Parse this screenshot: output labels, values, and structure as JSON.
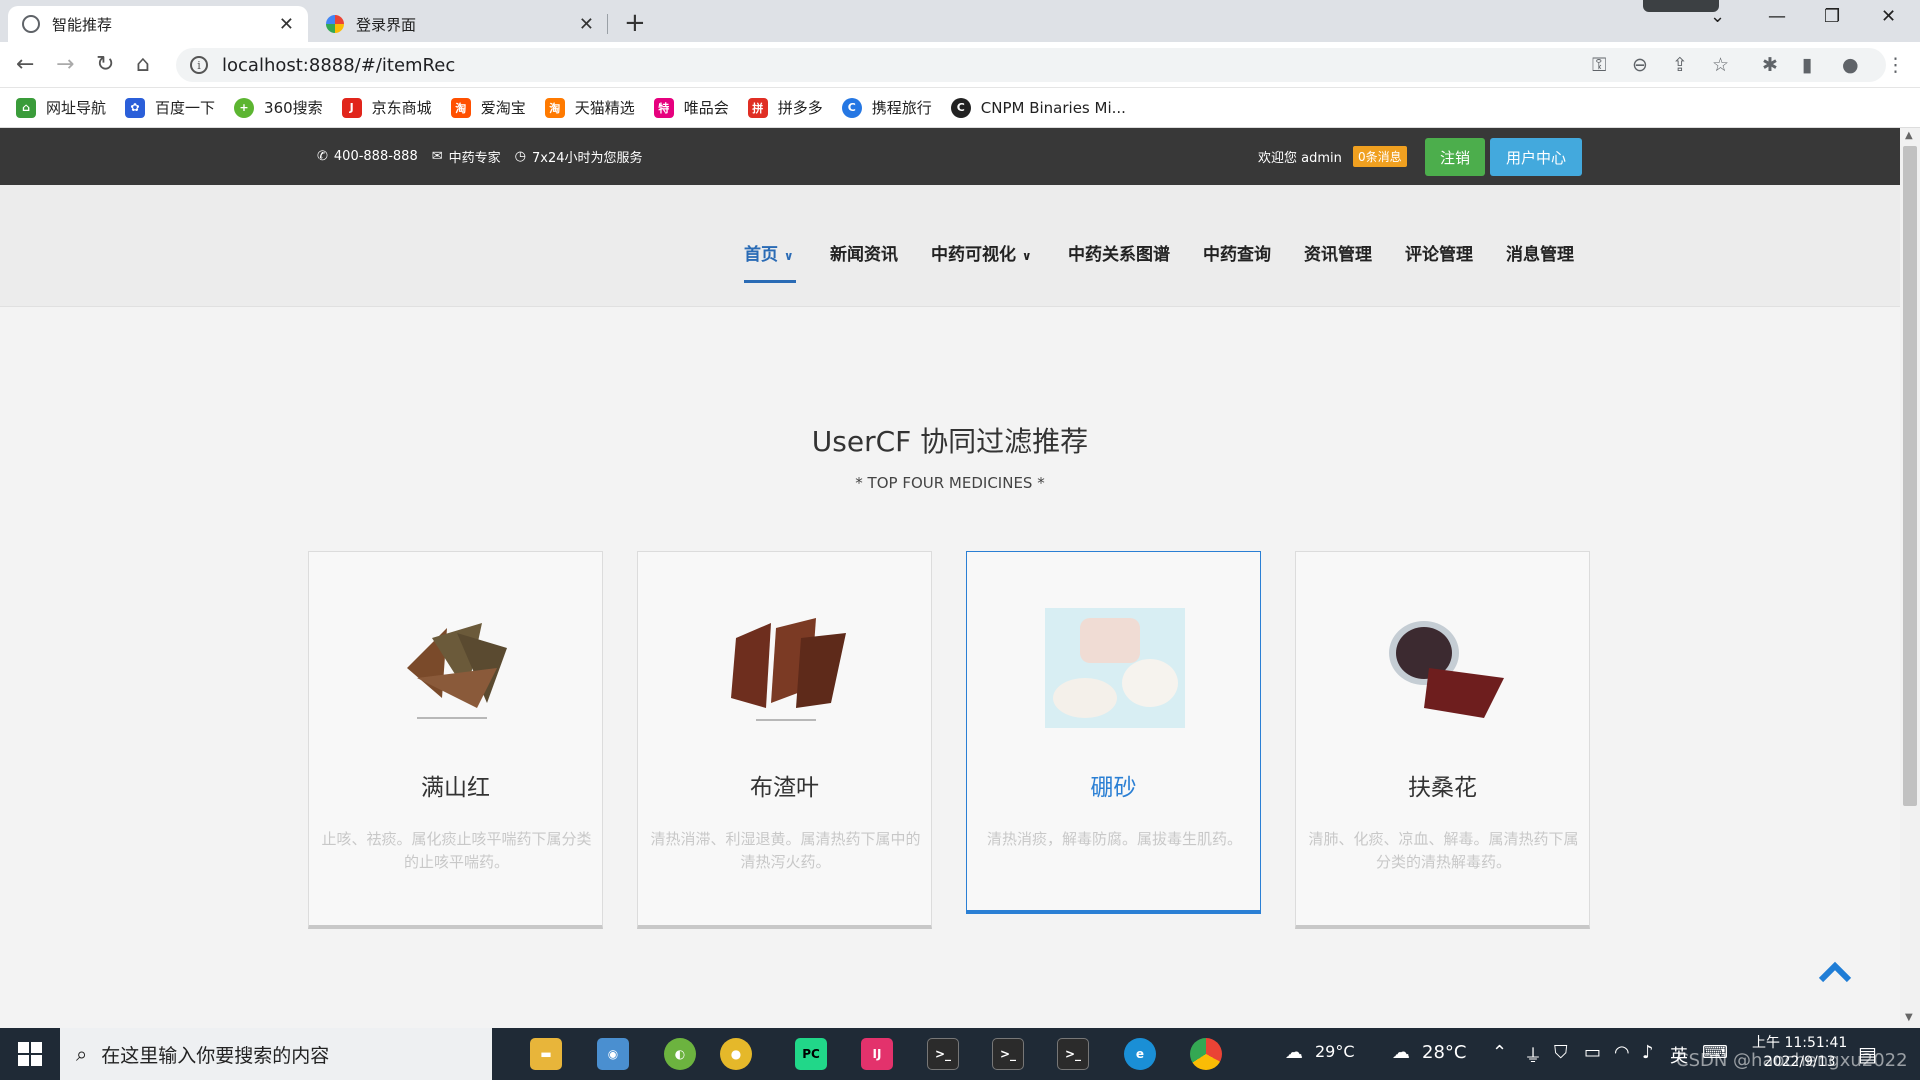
{
  "browser": {
    "tabs": [
      {
        "title": "智能推荐",
        "active": true
      },
      {
        "title": "登录界面",
        "active": false
      }
    ],
    "url": "localhost:8888/#/itemRec",
    "bookmarks": [
      {
        "label": "网址导航",
        "color": "#3a9c3a"
      },
      {
        "label": "百度一下",
        "color": "#2b5fd9"
      },
      {
        "label": "360搜索",
        "color": "#5cb531"
      },
      {
        "label": "京东商城",
        "color": "#e1251b"
      },
      {
        "label": "爱淘宝",
        "color": "#ff5000"
      },
      {
        "label": "天猫精选",
        "color": "#ff7a00"
      },
      {
        "label": "唯品会",
        "color": "#e6007e"
      },
      {
        "label": "拼多多",
        "color": "#e02e24"
      },
      {
        "label": "携程旅行",
        "color": "#2577e3"
      },
      {
        "label": "CNPM Binaries Mi...",
        "color": "#222222"
      }
    ]
  },
  "site": {
    "topbar": {
      "phone": "400-888-888",
      "email": "中药专家",
      "hours": "7x24小时为您服务",
      "welcome": "欢迎您 admin",
      "messages_badge": "0条消息",
      "logout_label": "注销",
      "user_center_label": "用户中心"
    },
    "nav": [
      {
        "label": "首页",
        "dropdown": true,
        "active": true
      },
      {
        "label": "新闻资讯",
        "dropdown": false,
        "active": false
      },
      {
        "label": "中药可视化",
        "dropdown": true,
        "active": false
      },
      {
        "label": "中药关系图谱",
        "dropdown": false,
        "active": false
      },
      {
        "label": "中药查询",
        "dropdown": false,
        "active": false
      },
      {
        "label": "资讯管理",
        "dropdown": false,
        "active": false
      },
      {
        "label": "评论管理",
        "dropdown": false,
        "active": false
      },
      {
        "label": "消息管理",
        "dropdown": false,
        "active": false
      }
    ],
    "section": {
      "title": "UserCF 协同过滤推荐",
      "subtitle": "* TOP FOUR MEDICINES *"
    },
    "cards": [
      {
        "name": "满山红",
        "desc": "止咳、祛痰。属化痰止咳平喘药下属分类的止咳平喘药。",
        "hovered": false
      },
      {
        "name": "布渣叶",
        "desc": "清热消滞、利湿退黄。属清热药下属中的清热泻火药。",
        "hovered": false
      },
      {
        "name": "硼砂",
        "desc": "清热消痰，解毒防腐。属拔毒生肌药。",
        "hovered": true
      },
      {
        "name": "扶桑花",
        "desc": "清肺、化痰、凉血、解毒。属清热药下属分类的清热解毒药。",
        "hovered": false
      }
    ],
    "accent_color": "#2a7fd4"
  },
  "taskbar": {
    "search_placeholder": "在这里输入你要搜索的内容",
    "weather1": "29°C",
    "weather2": "28°C",
    "ime": "英",
    "time": "上午 11:51:41",
    "date": "2022/9/13",
    "watermark": "CSDN @haochengxu2022"
  }
}
